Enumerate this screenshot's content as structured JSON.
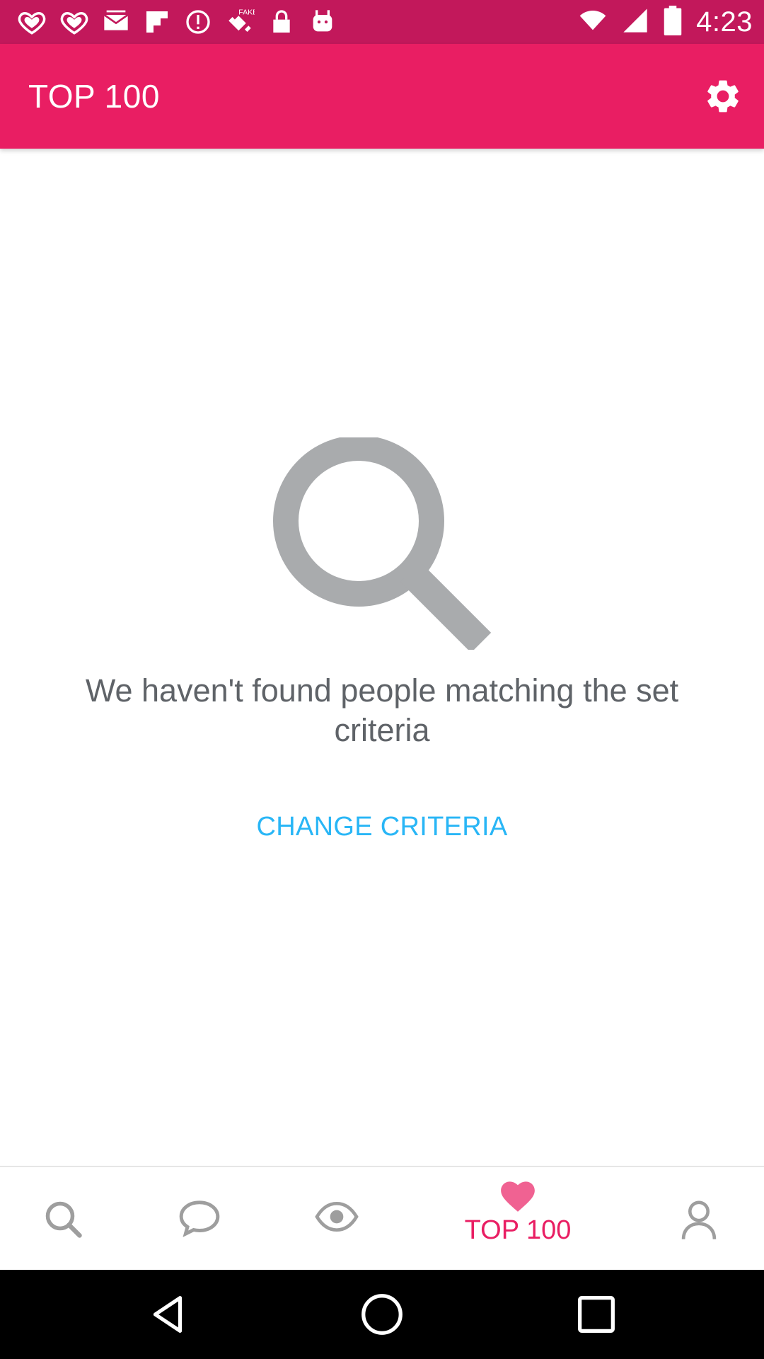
{
  "status_bar": {
    "time": "4:23",
    "left_icons": [
      "heart-notification-icon",
      "heart-notification-icon",
      "mail-icon",
      "flipboard-icon",
      "alert-icon",
      "fake-gps-satellite-icon",
      "lock-icon",
      "android-icon"
    ],
    "right_icons": [
      "wifi-icon",
      "signal-icon",
      "battery-icon"
    ],
    "background": "#c2185b"
  },
  "app_bar": {
    "title": "TOP 100",
    "background": "#e91e63",
    "settings_icon": "gear-icon"
  },
  "empty_state": {
    "icon": "magnifier-icon",
    "message": "We haven't found people matching the set criteria",
    "action_label": "CHANGE CRITERIA",
    "action_color": "#29b6f6"
  },
  "bottom_nav": {
    "items": [
      {
        "icon": "search-icon",
        "active": false
      },
      {
        "icon": "chat-bubble-icon",
        "active": false
      },
      {
        "icon": "eye-icon",
        "active": false
      },
      {
        "icon": "heart-icon",
        "label": "TOP 100",
        "active": true
      },
      {
        "icon": "person-icon",
        "active": false
      }
    ],
    "active_color": "#e91e63",
    "inactive_color": "#9e9e9e"
  },
  "system_nav": {
    "buttons": [
      "back-icon",
      "home-icon",
      "recents-icon"
    ]
  }
}
